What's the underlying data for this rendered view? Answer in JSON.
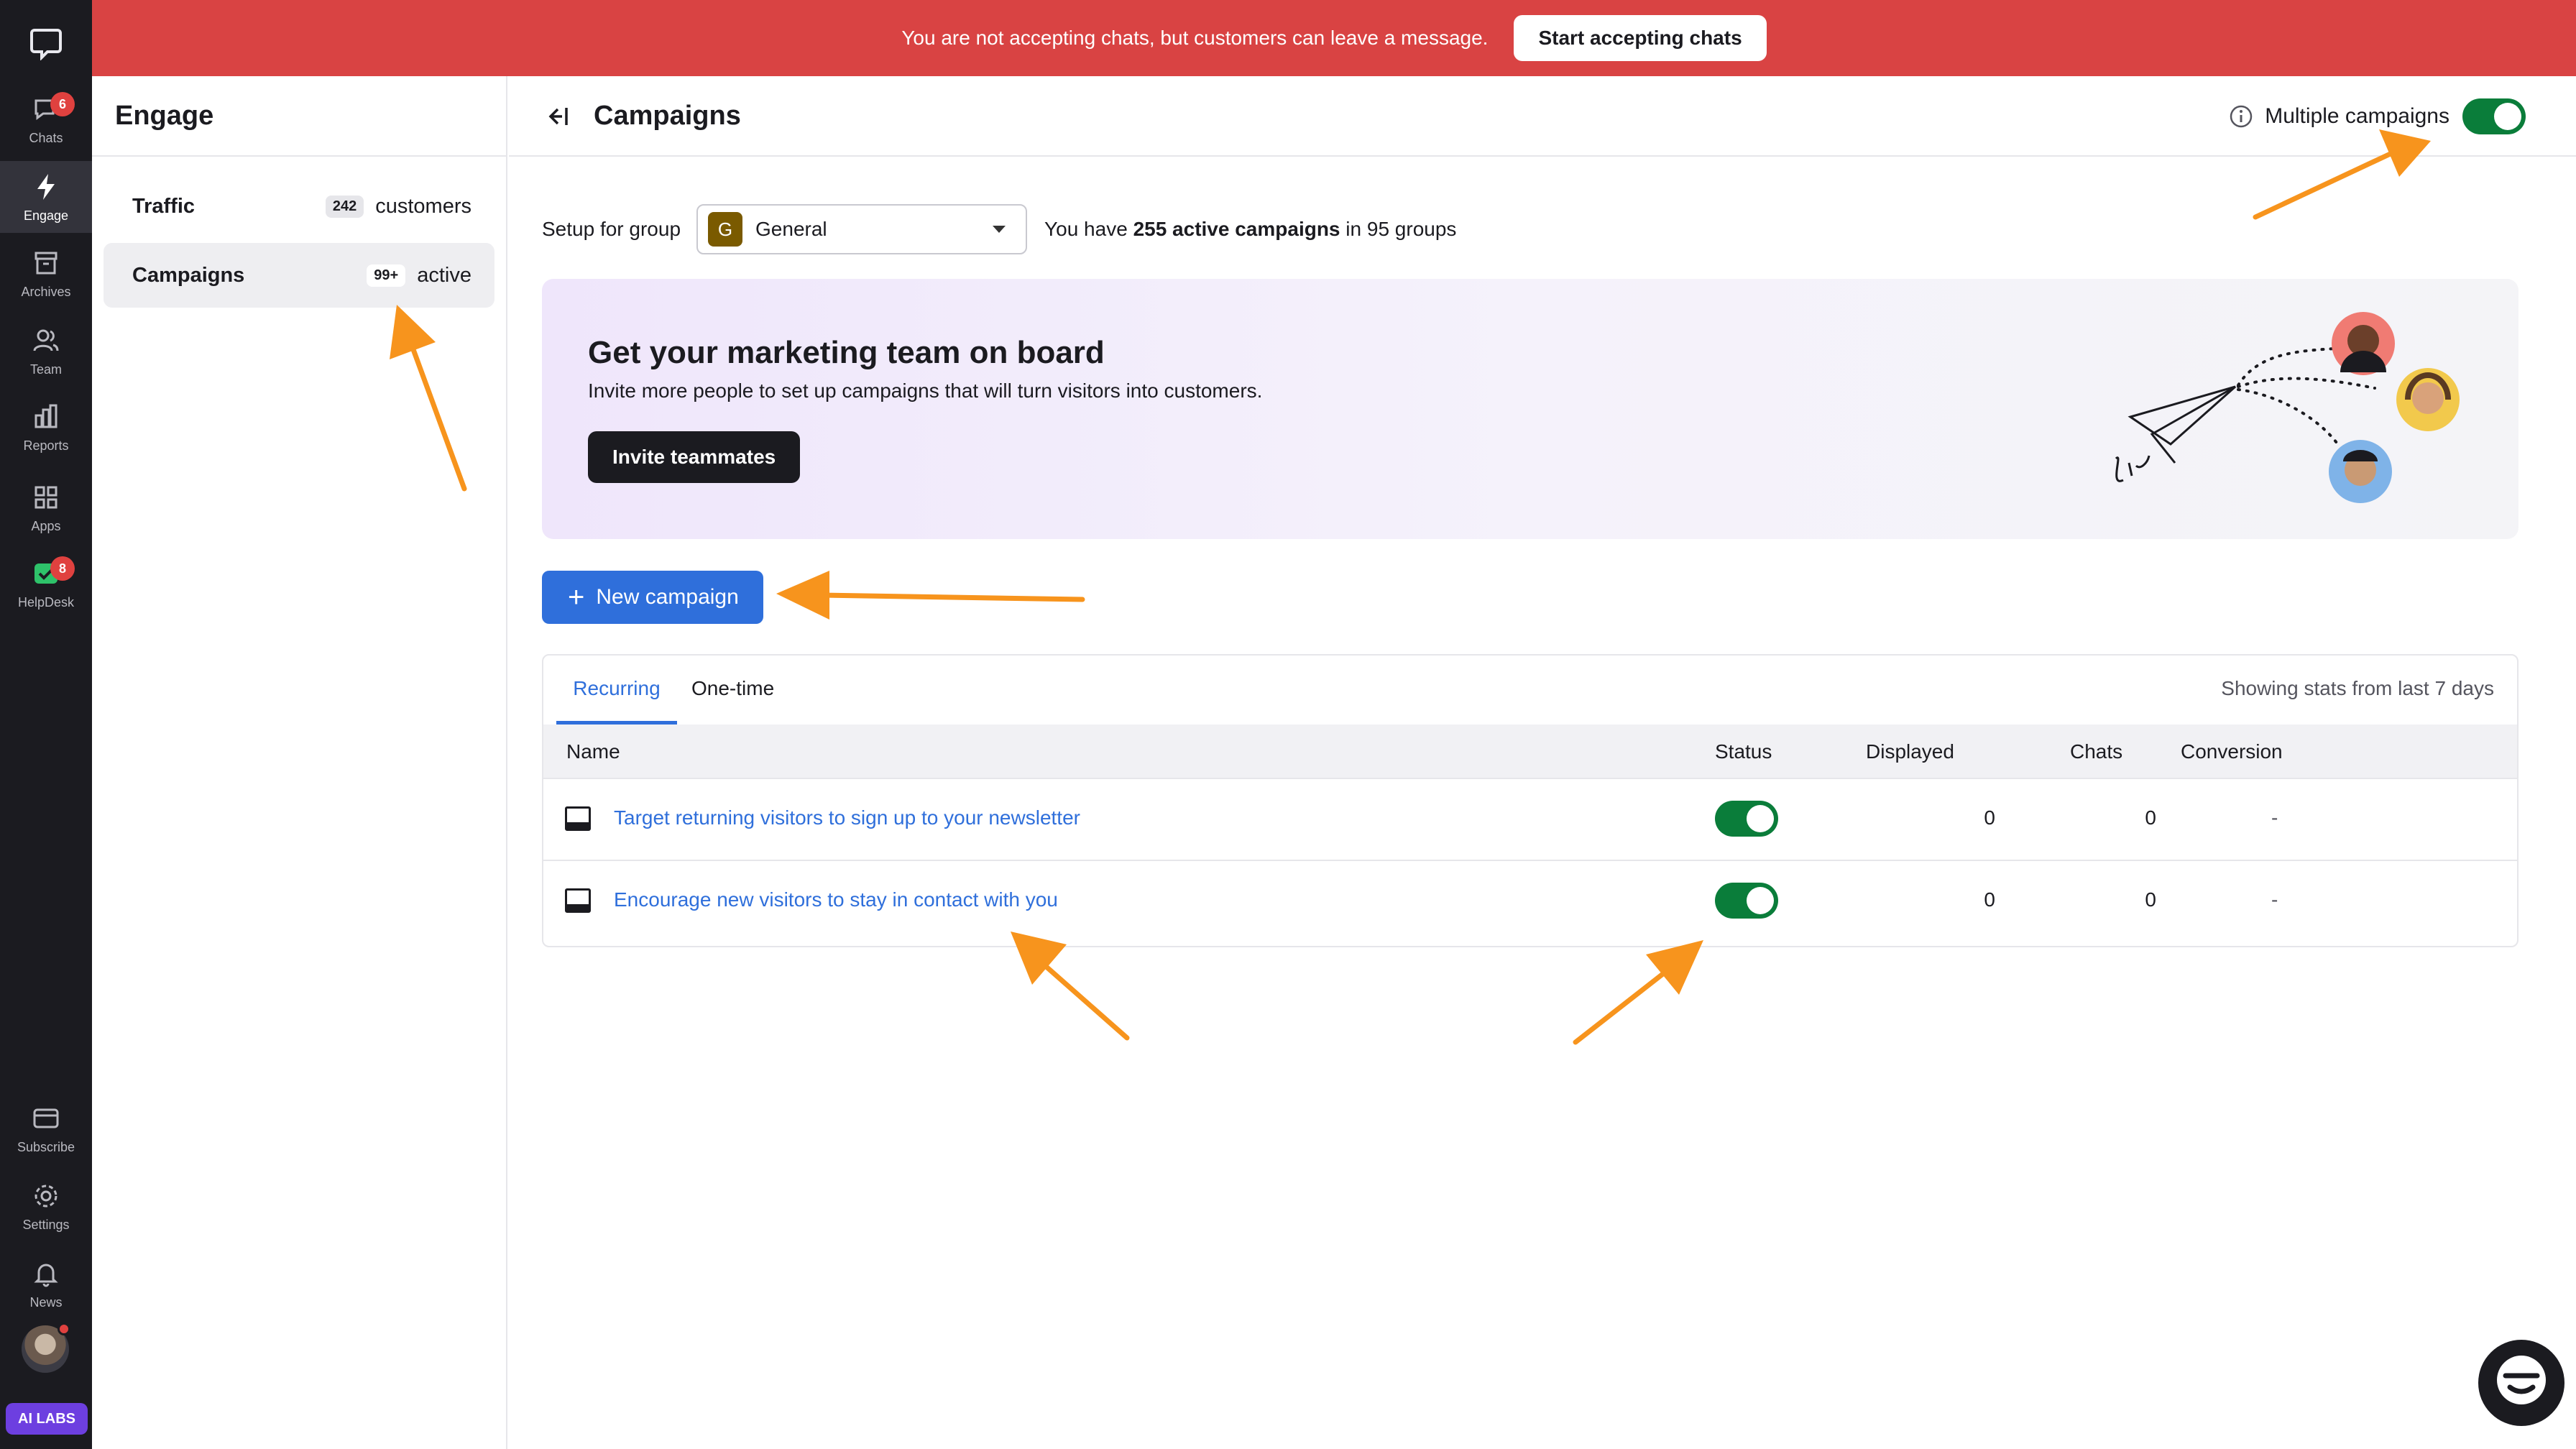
{
  "rail": {
    "items": [
      {
        "label": "Chats",
        "icon": "chat-icon",
        "badge": "6"
      },
      {
        "label": "Engage",
        "icon": "lightning-icon"
      },
      {
        "label": "Archives",
        "icon": "archive-icon"
      },
      {
        "label": "Team",
        "icon": "team-icon"
      },
      {
        "label": "Reports",
        "icon": "bar-chart-icon"
      },
      {
        "label": "Apps",
        "icon": "apps-grid-icon"
      },
      {
        "label": "HelpDesk",
        "icon": "helpdesk-icon",
        "badge": "8"
      },
      {
        "label": "Subscribe",
        "icon": "card-icon"
      },
      {
        "label": "Settings",
        "icon": "gear-icon"
      },
      {
        "label": "News",
        "icon": "bell-icon"
      }
    ],
    "ailabs": "AI LABS"
  },
  "banner": {
    "text": "You are not accepting chats, but customers can leave a message.",
    "button": "Start accepting chats"
  },
  "subnav": {
    "title": "Engage",
    "items": [
      {
        "label": "Traffic",
        "count": "242",
        "suffix": "customers"
      },
      {
        "label": "Campaigns",
        "count": "99+",
        "suffix": "active"
      }
    ]
  },
  "main": {
    "title": "Campaigns",
    "multiple_label": "Multiple campaigns",
    "multiple_on": true,
    "setup_label": "Setup for group",
    "group_initial": "G",
    "group_value": "General",
    "summary_pre": "You have ",
    "summary_bold": "255 active campaigns",
    "summary_post": " in 95 groups"
  },
  "promo": {
    "title": "Get your marketing team on board",
    "subtitle": "Invite more people to set up campaigns that will turn visitors into customers.",
    "button": "Invite teammates"
  },
  "new_campaign": "New campaign",
  "table": {
    "tabs": [
      "Recurring",
      "One-time"
    ],
    "showing": "Showing stats from last 7 days",
    "columns": {
      "name": "Name",
      "status": "Status",
      "displayed": "Displayed",
      "chats": "Chats",
      "conversion": "Conversion"
    },
    "rows": [
      {
        "name": "Target returning visitors to sign up to your newsletter",
        "status": true,
        "displayed": "0",
        "chats": "0",
        "conversion": "-"
      },
      {
        "name": "Encourage new visitors to stay in contact with you",
        "status": true,
        "displayed": "0",
        "chats": "0",
        "conversion": "-"
      }
    ]
  },
  "colors": {
    "banner": "#d94343",
    "accent": "#2f6fdb",
    "toggle_on": "#0a7d3a",
    "rail": "#1b1b20",
    "arrow": "#f7941d"
  }
}
